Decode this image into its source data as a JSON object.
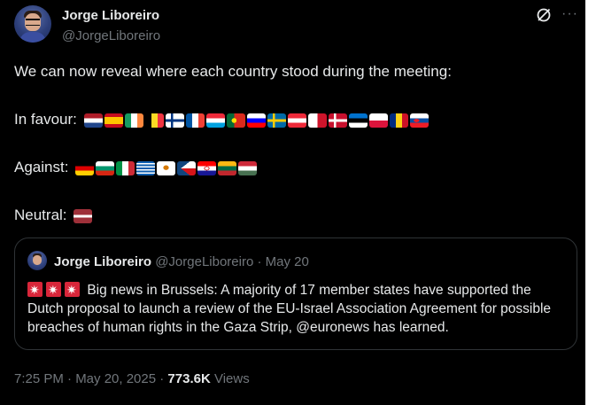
{
  "author": {
    "name": "Jorge Liboreiro",
    "handle": "@JorgeLiboreiro"
  },
  "tweet": {
    "intro": "We can now reveal where each country stood during the meeting:",
    "in_favour_label": "In favour:",
    "against_label": "Against:",
    "neutral_label": "Neutral:"
  },
  "flags": {
    "in_favour": [
      "netherlands-flag",
      "spain-flag",
      "ireland-flag",
      "belgium-flag",
      "finland-flag",
      "france-flag",
      "luxembourg-flag",
      "portugal-flag",
      "slovenia-flag",
      "sweden-flag",
      "austria-flag",
      "malta-flag",
      "denmark-flag",
      "estonia-flag",
      "poland-flag",
      "romania-flag",
      "slovakia-flag"
    ],
    "against": [
      "germany-flag",
      "bulgaria-flag",
      "italy-flag",
      "greece-flag",
      "cyprus-flag",
      "czechia-flag",
      "croatia-flag",
      "lithuania-flag",
      "hungary-flag"
    ],
    "neutral": [
      "latvia-flag"
    ]
  },
  "quote": {
    "name": "Jorge Liboreiro",
    "meta": "@JorgeLiboreiro · May 20",
    "icons": [
      "siren-icon",
      "siren-icon",
      "siren-icon"
    ],
    "text": "Big news in Brussels: A majority of 17 member states have supported the Dutch proposal to launch a review of the EU-Israel Association Agreement for possible breaches of human rights in the Gaza Strip, @euronews has learned."
  },
  "footer": {
    "timestamp": "7:25 PM · May 20, 2025 · ",
    "views_count": "773.6K",
    "views_label": " Views"
  },
  "icons": {
    "grok": "grok-icon",
    "more": "more-icon"
  }
}
